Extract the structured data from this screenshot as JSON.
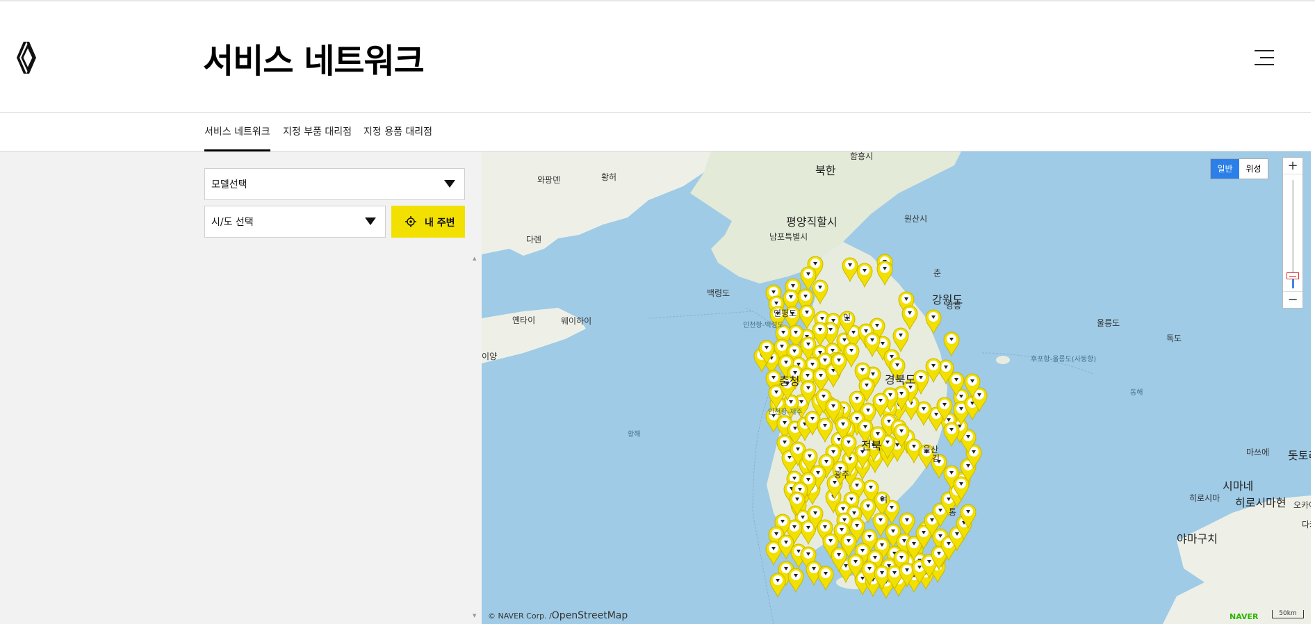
{
  "header": {
    "title": "서비스 네트워크",
    "logo_icon": "renault-diamond-icon",
    "menu_icon": "hamburger-menu-icon"
  },
  "tabs": [
    {
      "label": "서비스 네트워크",
      "active": true
    },
    {
      "label": "지정 부품 대리점",
      "active": false
    },
    {
      "label": "지정 용품 대리점",
      "active": false
    }
  ],
  "filters": {
    "model_select": "모델선택",
    "region_select": "시/도 선택",
    "nearby_button": "내 주변",
    "nearby_icon": "location-target-icon",
    "accent_color": "#f2e000"
  },
  "map": {
    "type_buttons": {
      "normal": "일반",
      "satellite": "위성"
    },
    "zoom": {
      "in": "+",
      "out": "−"
    },
    "copyright": "© NAVER Corp. /",
    "osm": "OpenStreetMap",
    "brand": "NAVER",
    "scale": "50km",
    "marker_color": "#f2e000",
    "labels": [
      {
        "text": "북한",
        "style": "big"
      },
      {
        "text": "함흥시",
        "style": "normal"
      },
      {
        "text": "황허",
        "style": "normal"
      },
      {
        "text": "와팡뎬",
        "style": "normal"
      },
      {
        "text": "평양직할시",
        "style": "big"
      },
      {
        "text": "원산시",
        "style": "normal"
      },
      {
        "text": "남포특별시",
        "style": "normal"
      },
      {
        "text": "다롄",
        "style": "normal"
      },
      {
        "text": "백령도",
        "style": "normal"
      },
      {
        "text": "연평도",
        "style": "normal"
      },
      {
        "text": "인천항-백령도",
        "style": "sea"
      },
      {
        "text": "강원도",
        "style": "big"
      },
      {
        "text": "강릉",
        "style": "normal"
      },
      {
        "text": "옌타이",
        "style": "normal"
      },
      {
        "text": "웨이하이",
        "style": "normal"
      },
      {
        "text": "울릉도",
        "style": "normal"
      },
      {
        "text": "독도",
        "style": "normal"
      },
      {
        "text": "후포항-울릉도(사동항)",
        "style": "sea"
      },
      {
        "text": "이양",
        "style": "normal"
      },
      {
        "text": "경북도",
        "style": "big"
      },
      {
        "text": "충청",
        "style": "big"
      },
      {
        "text": "동해",
        "style": "sea"
      },
      {
        "text": "황해",
        "style": "sea"
      },
      {
        "text": "인천항-제주",
        "style": "sea"
      },
      {
        "text": "전북",
        "style": "big"
      },
      {
        "text": "울산",
        "style": "normal"
      },
      {
        "text": "마쓰에",
        "style": "normal"
      },
      {
        "text": "돗토리",
        "style": "big"
      },
      {
        "text": "시마네",
        "style": "big"
      },
      {
        "text": "히로시마현",
        "style": "big"
      },
      {
        "text": "히로시마",
        "style": "normal"
      },
      {
        "text": "오카야",
        "style": "normal"
      },
      {
        "text": "야마구치",
        "style": "big"
      },
      {
        "text": "다카",
        "style": "normal"
      },
      {
        "text": "광주",
        "style": "normal"
      },
      {
        "text": "여",
        "style": "normal"
      },
      {
        "text": "통",
        "style": "normal"
      },
      {
        "text": "김",
        "style": "normal"
      },
      {
        "text": "인",
        "style": "normal"
      },
      {
        "text": "춘",
        "style": "normal"
      }
    ]
  }
}
